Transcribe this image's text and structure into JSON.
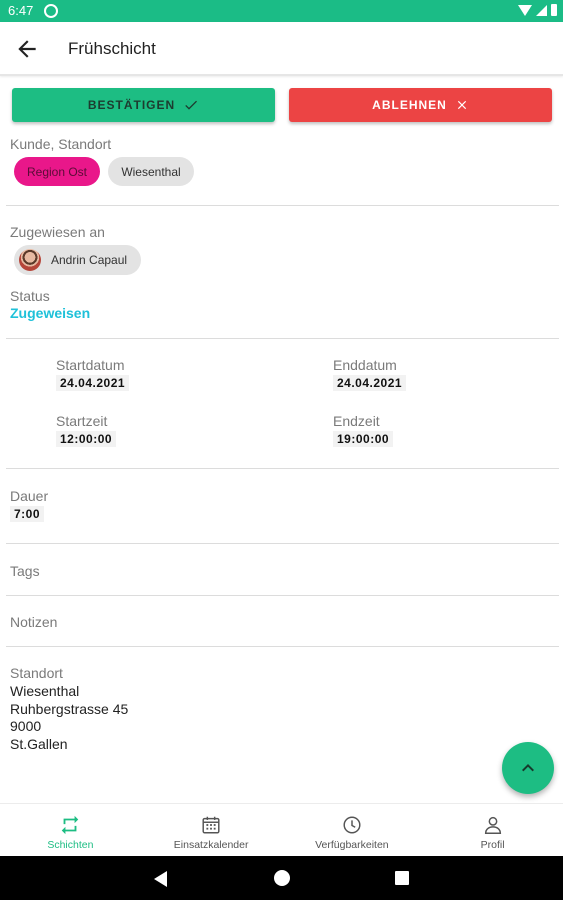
{
  "status_bar": {
    "time": "6:47"
  },
  "appbar": {
    "title": "Frühschicht"
  },
  "actions": {
    "confirm_label": "BESTÄTIGEN",
    "reject_label": "ABLEHNEN"
  },
  "customer": {
    "label": "Kunde, Standort",
    "chips": [
      "Region Ost",
      "Wiesenthal"
    ],
    "region_color": "#e9178a"
  },
  "assigned": {
    "label": "Zugewiesen an",
    "user": "Andrin Capaul"
  },
  "status": {
    "label": "Status",
    "value": "Zugeweisen",
    "color": "#1fc1d9"
  },
  "schedule": {
    "start_date_label": "Startdatum",
    "start_date": "24.04.2021",
    "end_date_label": "Enddatum",
    "end_date": "24.04.2021",
    "start_time_label": "Startzeit",
    "start_time": "12:00:00",
    "end_time_label": "Endzeit",
    "end_time": "19:00:00"
  },
  "duration": {
    "label": "Dauer",
    "value": "7:00"
  },
  "tags": {
    "label": "Tags"
  },
  "notes": {
    "label": "Notizen"
  },
  "location": {
    "label": "Standort",
    "name": "Wiesenthal",
    "street": "Ruhbergstrasse 45",
    "zip": "9000",
    "city": "St.Gallen"
  },
  "bottom_nav": {
    "items": [
      {
        "label": "Schichten",
        "icon": "swap-arrows-icon",
        "active": true
      },
      {
        "label": "Einsatzkalender",
        "icon": "calendar-icon",
        "active": false
      },
      {
        "label": "Verfügbarkeiten",
        "icon": "clock-icon",
        "active": false
      },
      {
        "label": "Profil",
        "icon": "person-icon",
        "active": false
      }
    ]
  },
  "colors": {
    "primary": "#1dbd83",
    "danger": "#ec4444",
    "status_bar": "#1bbc86"
  }
}
